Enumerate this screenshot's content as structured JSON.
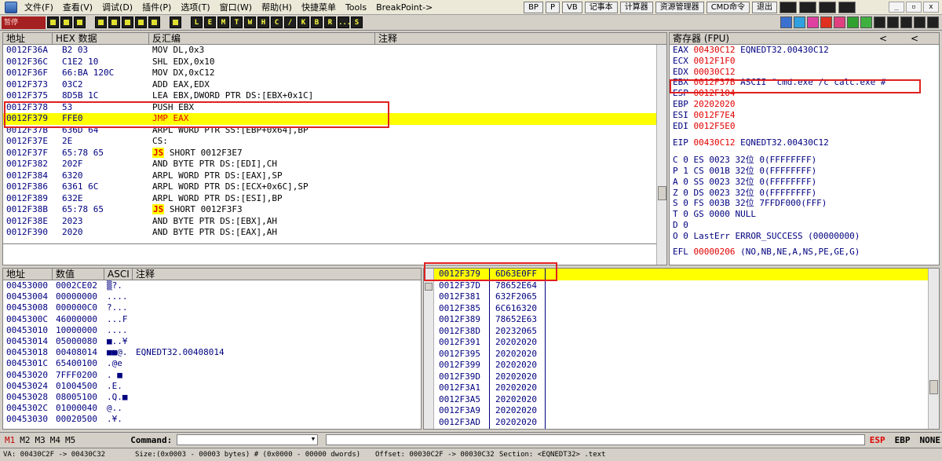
{
  "menu": {
    "items": [
      "文件(F)",
      "查看(V)",
      "调试(D)",
      "插件(P)",
      "选项(T)",
      "窗口(W)",
      "帮助(H)",
      "快捷菜单",
      "Tools",
      "BreakPoint->"
    ],
    "right_buttons": [
      "BP",
      "P",
      "VB",
      "记事本",
      "计算器",
      "资源管理器",
      "CMD命令",
      "退出"
    ],
    "window_controls": [
      "_",
      "▫",
      "x"
    ]
  },
  "toolbar": {
    "status": "暂停",
    "letters": [
      "L",
      "E",
      "M",
      "T",
      "W",
      "H",
      "C",
      "/",
      "K",
      "B",
      "R",
      "...",
      "S"
    ]
  },
  "disasm": {
    "headers": [
      "地址",
      "HEX 数据",
      "反汇编",
      "注释"
    ],
    "rows": [
      {
        "addr": "0012F36A",
        "hex": "B2 03",
        "dis": "MOV DL,0x3",
        "js": "",
        "hl": false
      },
      {
        "addr": "0012F36C",
        "hex": "C1E2 10",
        "dis": "SHL EDX,0x10",
        "js": "",
        "hl": false
      },
      {
        "addr": "0012F36F",
        "hex": "66:BA 120C",
        "dis": "MOV DX,0xC12",
        "js": "",
        "hl": false
      },
      {
        "addr": "0012F373",
        "hex": "03C2",
        "dis": "ADD EAX,EDX",
        "js": "",
        "hl": false
      },
      {
        "addr": "0012F375",
        "hex": "8D5B 1C",
        "dis": "LEA EBX,DWORD PTR DS:[EBX+0x1C]",
        "js": "",
        "hl": false
      },
      {
        "addr": "0012F378",
        "hex": "53",
        "dis": "PUSH EBX",
        "js": "",
        "hl": false
      },
      {
        "addr": "0012F379",
        "hex": "FFE0",
        "dis": "JMP EAX",
        "js": "",
        "hl": true
      },
      {
        "addr": "0012F37B",
        "hex": "636D 64",
        "dis": "ARPL WORD PTR SS:[EBP+0x64],BP",
        "js": "",
        "hl": false
      },
      {
        "addr": "0012F37E",
        "hex": "2E",
        "dis": "CS:",
        "js": "",
        "hl": false
      },
      {
        "addr": "0012F37F",
        "hex": "65:78 65",
        "dis": "SHORT 0012F3E7",
        "js": "JS",
        "hl": false
      },
      {
        "addr": "0012F382",
        "hex": "202F",
        "dis": "AND BYTE PTR DS:[EDI],CH",
        "js": "",
        "hl": false
      },
      {
        "addr": "0012F384",
        "hex": "6320",
        "dis": "ARPL WORD PTR DS:[EAX],SP",
        "js": "",
        "hl": false
      },
      {
        "addr": "0012F386",
        "hex": "6361 6C",
        "dis": "ARPL WORD PTR DS:[ECX+0x6C],SP",
        "js": "",
        "hl": false
      },
      {
        "addr": "0012F389",
        "hex": "632E",
        "dis": "ARPL WORD PTR DS:[ESI],BP",
        "js": "",
        "hl": false
      },
      {
        "addr": "0012F38B",
        "hex": "65:78 65",
        "dis": "SHORT 0012F3F3",
        "js": "JS",
        "hl": false
      },
      {
        "addr": "0012F38E",
        "hex": "2023",
        "dis": "AND BYTE PTR DS:[EBX],AH",
        "js": "",
        "hl": false
      },
      {
        "addr": "0012F390",
        "hex": "2020",
        "dis": "AND BYTE PTR DS:[EAX],AH",
        "js": "",
        "hl": false
      }
    ]
  },
  "registers": {
    "header": "寄存器 (FPU)",
    "arrows": [
      "<",
      "<"
    ],
    "rows": [
      {
        "name": "EAX",
        "val": "00430C12",
        "rest": "EQNEDT32.00430C12"
      },
      {
        "name": "ECX",
        "val": "0012F1F0",
        "rest": ""
      },
      {
        "name": "EDX",
        "val": "00030C12",
        "rest": ""
      },
      {
        "name": "EBX",
        "val": "0012F37B",
        "rest": "ASCII \"cmd.exe /c calc.exe #"
      },
      {
        "name": "ESP",
        "val": "0012F104",
        "rest": ""
      },
      {
        "name": "EBP",
        "val": "20202020",
        "rest": ""
      },
      {
        "name": "ESI",
        "val": "0012F7E4",
        "rest": ""
      },
      {
        "name": "EDI",
        "val": "0012F5E0",
        "rest": ""
      }
    ],
    "eip": {
      "name": "EIP",
      "val": "00430C12",
      "rest": "EQNEDT32.00430C12"
    },
    "flags": [
      "C 0  ES 0023 32位 0(FFFFFFFF)",
      "P 1  CS 001B 32位 0(FFFFFFFF)",
      "A 0  SS 0023 32位 0(FFFFFFFF)",
      "Z 0  DS 0023 32位 0(FFFFFFFF)",
      "S 0  FS 003B 32位 7FFDF000(FFF)",
      "T 0  GS 0000 NULL",
      "D 0",
      "O 0  LastErr ERROR_SUCCESS (00000000)"
    ],
    "efl": {
      "name": "EFL",
      "val": "00000206",
      "rest": "(NO,NB,NE,A,NS,PE,GE,G)"
    }
  },
  "dump": {
    "headers": [
      "地址",
      "数值",
      "ASCI",
      "注释"
    ],
    "rows": [
      {
        "addr": "00453000",
        "val": "0002CE02",
        "asc": "▒?.",
        "com": ""
      },
      {
        "addr": "00453004",
        "val": "00000000",
        "asc": "....",
        "com": ""
      },
      {
        "addr": "00453008",
        "val": "000000C0",
        "asc": "?...",
        "com": ""
      },
      {
        "addr": "0045300C",
        "val": "46000000",
        "asc": "...F",
        "com": ""
      },
      {
        "addr": "00453010",
        "val": "10000000",
        "asc": "....",
        "com": ""
      },
      {
        "addr": "00453014",
        "val": "05000080",
        "asc": "■..¥",
        "com": ""
      },
      {
        "addr": "00453018",
        "val": "00408014",
        "asc": "■■@.",
        "com": "EQNEDT32.00408014"
      },
      {
        "addr": "0045301C",
        "val": "65400100",
        "asc": ".@e",
        "com": ""
      },
      {
        "addr": "00453020",
        "val": "7FFF0200",
        "asc": ". ■",
        "com": ""
      },
      {
        "addr": "00453024",
        "val": "01004500",
        "asc": ".E.",
        "com": ""
      },
      {
        "addr": "00453028",
        "val": "08005100",
        "asc": ".Q.■",
        "com": ""
      },
      {
        "addr": "0045302C",
        "val": "01000040",
        "asc": "@..",
        "com": ""
      },
      {
        "addr": "00453030",
        "val": "00020500",
        "asc": ".¥.",
        "com": ""
      }
    ]
  },
  "stack": {
    "rows": [
      {
        "addr": "0012F379",
        "val": "6D63E0FF",
        "hl": true
      },
      {
        "addr": "0012F37D",
        "val": "78652E64",
        "hl": false
      },
      {
        "addr": "0012F381",
        "val": "632F2065",
        "hl": false
      },
      {
        "addr": "0012F385",
        "val": "6C616320",
        "hl": false
      },
      {
        "addr": "0012F389",
        "val": "78652E63",
        "hl": false
      },
      {
        "addr": "0012F38D",
        "val": "20232065",
        "hl": false
      },
      {
        "addr": "0012F391",
        "val": "20202020",
        "hl": false
      },
      {
        "addr": "0012F395",
        "val": "20202020",
        "hl": false
      },
      {
        "addr": "0012F399",
        "val": "20202020",
        "hl": false
      },
      {
        "addr": "0012F39D",
        "val": "20202020",
        "hl": false
      },
      {
        "addr": "0012F3A1",
        "val": "20202020",
        "hl": false
      },
      {
        "addr": "0012F3A5",
        "val": "20202020",
        "hl": false
      },
      {
        "addr": "0012F3A9",
        "val": "20202020",
        "hl": false
      },
      {
        "addr": "0012F3AD",
        "val": "20202020",
        "hl": false
      }
    ]
  },
  "cmdbar": {
    "mem_tabs": [
      "M1",
      "M2",
      "M3",
      "M4",
      "M5"
    ],
    "command_label": "Command:",
    "reg_buttons": [
      "ESP",
      "EBP",
      "NONE"
    ]
  },
  "statusbar": {
    "va": "VA: 00430C2F -> 00430C32",
    "size": "Size:(0x0003 - 00003 bytes)  #  (0x0000 - 00000 dwords)",
    "offset": "Offset: 00030C2F -> 00030C32",
    "section": "Section: <EQNEDT32> .text"
  }
}
